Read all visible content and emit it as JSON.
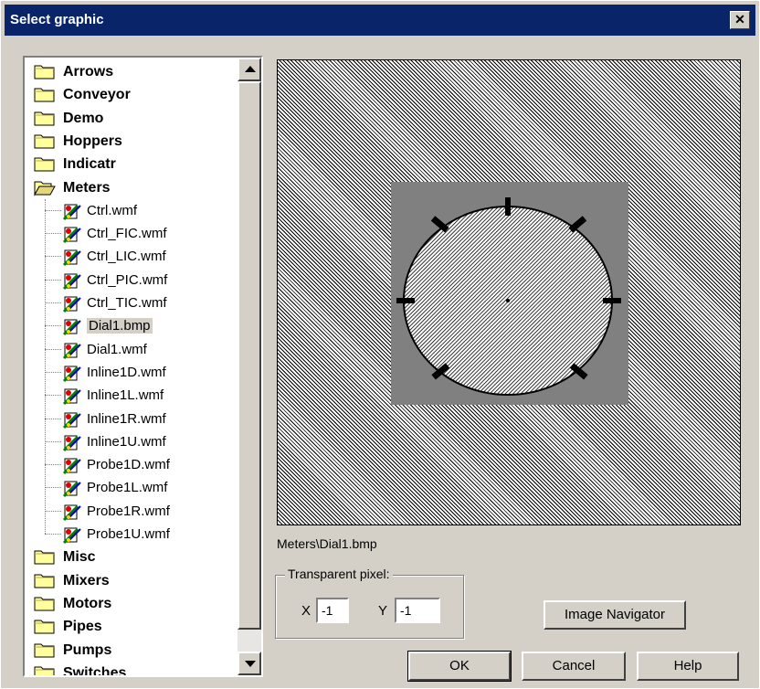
{
  "window": {
    "title": "Select graphic",
    "close_glyph": "✕"
  },
  "tree": {
    "folders_top": [
      "Arrows",
      "Conveyor",
      "Demo",
      "Hoppers",
      "Indicatr"
    ],
    "expanded_folder": "Meters",
    "files": [
      "Ctrl.wmf",
      "Ctrl_FIC.wmf",
      "Ctrl_LIC.wmf",
      "Ctrl_PIC.wmf",
      "Ctrl_TIC.wmf",
      "Dial1.bmp",
      "Dial1.wmf",
      "Inline1D.wmf",
      "Inline1L.wmf",
      "Inline1R.wmf",
      "Inline1U.wmf",
      "Probe1D.wmf",
      "Probe1L.wmf",
      "Probe1R.wmf",
      "Probe1U.wmf"
    ],
    "selected_file": "Dial1.bmp",
    "folders_bottom": [
      "Misc",
      "Mixers",
      "Motors",
      "Pipes",
      "Pumps",
      "Switches"
    ]
  },
  "preview": {
    "path": "Meters\\Dial1.bmp",
    "image_bg": "#808080"
  },
  "transparent_pixel": {
    "title": "Transparent pixel:",
    "x_label": "X",
    "x_value": "-1",
    "y_label": "Y",
    "y_value": "-1"
  },
  "buttons": {
    "image_navigator": "Image Navigator",
    "ok": "OK",
    "cancel": "Cancel",
    "help": "Help"
  }
}
